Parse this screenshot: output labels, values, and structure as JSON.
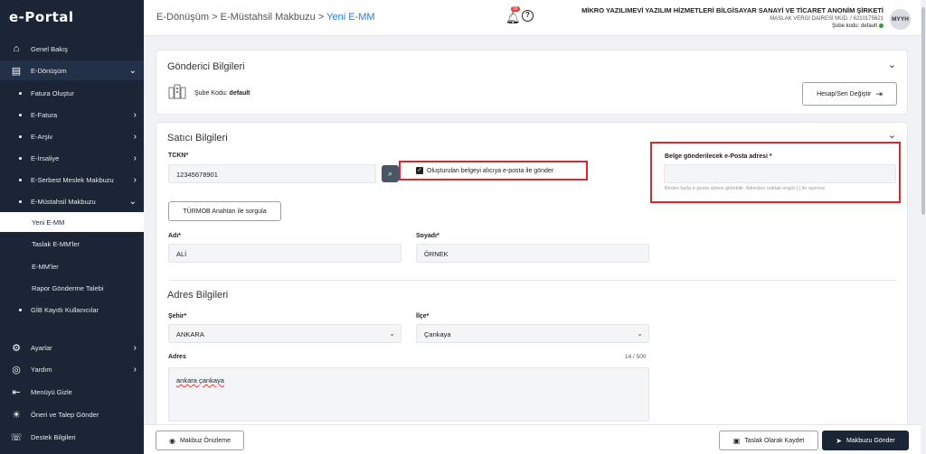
{
  "sidebar": {
    "logo": "e-Portal",
    "items": [
      {
        "label": "Genel Bakış",
        "icon": "home-icon"
      },
      {
        "label": "E-Dönüşüm",
        "icon": "document-icon"
      },
      {
        "label": "Fatura Oluştur"
      },
      {
        "label": "E-Fatura"
      },
      {
        "label": "E-Arşiv"
      },
      {
        "label": "E-İrsaliye"
      },
      {
        "label": "E-Serbest Meslek Makbuzu"
      },
      {
        "label": "E-Müstahsil Makbuzu"
      },
      {
        "label": "Yeni E-MM"
      },
      {
        "label": "Taslak E-MM'ler"
      },
      {
        "label": "E-MM'ler"
      },
      {
        "label": "Rapor Gönderme Talebi"
      },
      {
        "label": "GİB Kayıtlı Kullanıcılar"
      },
      {
        "label": "Ayarlar",
        "icon": "gear-icon"
      },
      {
        "label": "Yardım",
        "icon": "lifebuoy-icon"
      },
      {
        "label": "Menüyü Gizle",
        "icon": "collapse-icon"
      },
      {
        "label": "Öneri ve Talep Gönder",
        "icon": "bulb-icon"
      },
      {
        "label": "Destek Bilgileri",
        "icon": "support-icon"
      }
    ]
  },
  "header": {
    "breadcrumb": [
      "E-Dönüşüm",
      "E-Müstahsil Makbuzu",
      "Yeni E-MM"
    ],
    "notification_count": "99",
    "company_name": "MİKRO YAZILIMEVİ YAZILIM HİZMETLERİ BİLGİSAYAR SANAYİ VE TİCARET ANONİM ŞİRKETİ",
    "tax_office": "MASLAK VERGİ DAİRESİ MÜD. / 6210175621",
    "branch_label": "Şube kodu:",
    "branch_value": "default",
    "avatar": "MYYH"
  },
  "sender": {
    "title": "Gönderici Bilgileri",
    "branch_label": "Şube Kodu:",
    "branch_value": "default",
    "change_button": "Hesap/Seri Değiştir"
  },
  "seller": {
    "title": "Satıcı Bilgileri",
    "tckn_label": "TCKN*",
    "tckn_value": "12345678901",
    "send_email_checkbox": "Oluşturulan belgeyi alıcıya e-posta ile gönder",
    "email_label": "Belge gönderilecek e-Posta adresi *",
    "email_value": "",
    "email_hint": "Birden fazla e-posta adresi girilebilir. Adresleri noktalı virgül (;) ile ayırınız.",
    "turmob_button": "TÜRMOB Anahtarı ile sorgula",
    "name_label": "Adı*",
    "name_value": "ALİ",
    "surname_label": "Soyadı*",
    "surname_value": "ÖRNEK"
  },
  "address": {
    "title": "Adres Bilgileri",
    "city_label": "Şehir*",
    "city_value": "ANKARA",
    "district_label": "İlçe*",
    "district_value": "Çankaya",
    "address_label": "Adres",
    "address_count": "14 / 500",
    "address_value": "ankara çankaya"
  },
  "footer": {
    "preview_button": "Makbuz Önizleme",
    "draft_button": "Taslak Olarak Kaydet",
    "send_button": "Makbuzu Gönder"
  },
  "colors": {
    "sidebar_bg": "#1b2535",
    "accent": "#2a7be4",
    "highlight_red": "#e0242c",
    "primary_button": "#1b2535"
  }
}
